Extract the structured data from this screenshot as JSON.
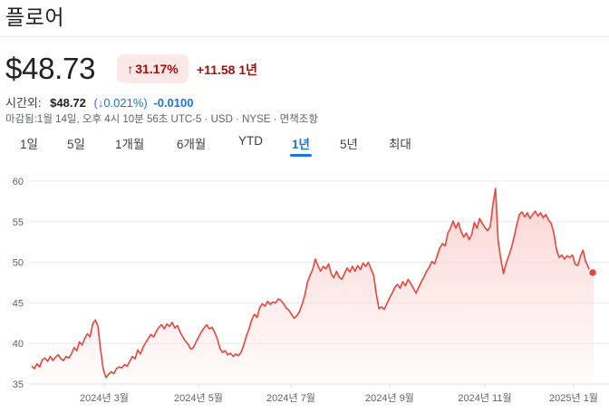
{
  "header": {
    "title": "플로어"
  },
  "quote": {
    "price": "$48.73",
    "change_badge": {
      "arrow": "↑",
      "percent": "31.17%"
    },
    "change_value": "+11.58 1년"
  },
  "after_hours": {
    "label": "시간외:",
    "price": "$48.72",
    "percent": "(↓0.021%)",
    "change": "-0.0100"
  },
  "meta": "마감됨:1월 14일, 오후 4시 10분 56초 UTC-5 · USD · NYSE · 면책조항",
  "tabs": [
    {
      "label": "1일",
      "active": false
    },
    {
      "label": "5일",
      "active": false
    },
    {
      "label": "1개월",
      "active": false
    },
    {
      "label": "6개월",
      "active": false
    },
    {
      "label": "YTD",
      "active": false
    },
    {
      "label": "1년",
      "active": true
    },
    {
      "label": "5년",
      "active": false
    },
    {
      "label": "최대",
      "active": false
    }
  ],
  "colors": {
    "line": "#e8453c",
    "fill_top": "#fbd3d0",
    "grid": "#e8eaed",
    "accent": "#1a73e8",
    "down": "#a50e0e"
  },
  "chart_data": {
    "type": "line",
    "x_axis_labels": [
      "2024년 3월",
      "2024년 5월",
      "2024년 7월",
      "2024년 9월",
      "2024년 11월",
      "2025년 1월"
    ],
    "y_ticks": [
      35,
      40,
      45,
      50,
      55,
      60
    ],
    "ylim": [
      35,
      61
    ],
    "grid": true,
    "series": [
      {
        "values": [
          37.2,
          36.9,
          37.5,
          37.1,
          38.0,
          38.2,
          37.8,
          38.4,
          37.9,
          38.3,
          38.6,
          38.1,
          37.9,
          38.4,
          38.2,
          38.7,
          39.5,
          39.1,
          40.2,
          39.8,
          40.6,
          41.2,
          40.8,
          42.4,
          42.9,
          42.1,
          39.2,
          36.8,
          35.8,
          36.2,
          36.5,
          36.3,
          36.9,
          37.1,
          37.0,
          37.4,
          37.2,
          37.8,
          38.4,
          38.1,
          39.2,
          38.7,
          39.5,
          40.1,
          40.6,
          41.1,
          40.8,
          41.5,
          42.0,
          42.3,
          41.8,
          42.4,
          42.1,
          42.6,
          41.9,
          42.2,
          41.4,
          40.8,
          40.3,
          39.9,
          39.3,
          39.5,
          40.2,
          40.8,
          41.4,
          41.9,
          42.3,
          41.8,
          42.0,
          41.4,
          40.6,
          39.4,
          38.9,
          39.1,
          38.6,
          38.8,
          38.4,
          38.7,
          38.5,
          38.9,
          39.8,
          40.9,
          41.8,
          42.9,
          43.6,
          43.2,
          44.4,
          44.9,
          44.6,
          45.2,
          44.8,
          45.1,
          45.0,
          45.5,
          45.3,
          44.9,
          44.4,
          44.1,
          43.6,
          43.1,
          43.4,
          43.9,
          44.8,
          45.9,
          47.5,
          48.4,
          49.1,
          50.4,
          49.6,
          48.9,
          49.5,
          49.2,
          49.8,
          48.6,
          48.1,
          48.9,
          48.2,
          47.9,
          48.6,
          49.3,
          48.8,
          49.5,
          48.9,
          49.6,
          49.1,
          49.9,
          49.5,
          50.0,
          49.2,
          48.4,
          46.1,
          44.3,
          44.5,
          44.2,
          44.9,
          45.6,
          46.2,
          46.9,
          47.3,
          46.8,
          47.6,
          47.1,
          47.9,
          47.4,
          46.8,
          46.2,
          46.9,
          47.6,
          48.2,
          48.9,
          49.4,
          50.1,
          49.8,
          50.8,
          51.8,
          52.3,
          52.0,
          53.6,
          54.2,
          55.1,
          54.2,
          54.9,
          53.8,
          53.1,
          53.6,
          52.8,
          53.4,
          54.9,
          54.2,
          55.4,
          54.8,
          54.3,
          53.9,
          54.4,
          57.1,
          59.1,
          52.6,
          50.4,
          48.6,
          49.9,
          50.8,
          51.8,
          53.1,
          54.6,
          55.9,
          56.2,
          55.6,
          56.1,
          55.4,
          55.9,
          56.3,
          55.7,
          56.1,
          55.5,
          55.9,
          55.2,
          54.8,
          53.6,
          51.6,
          50.6,
          50.9,
          50.4,
          50.8,
          50.6,
          50.9,
          49.8,
          49.6,
          50.7,
          51.5,
          50.1,
          49.4,
          48.7,
          48.73
        ]
      }
    ]
  }
}
